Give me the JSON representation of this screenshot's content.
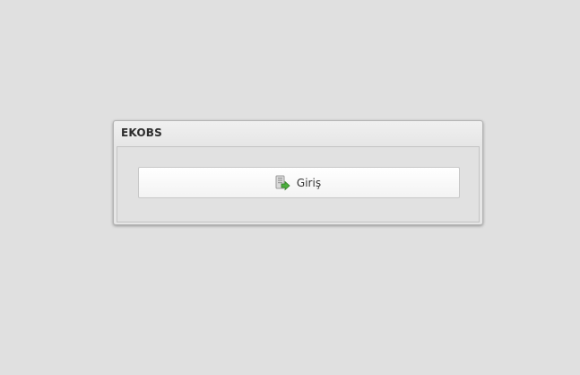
{
  "panel": {
    "title": "EKOBS"
  },
  "login": {
    "label": "Giriş",
    "icon": "login-arrow-icon"
  }
}
